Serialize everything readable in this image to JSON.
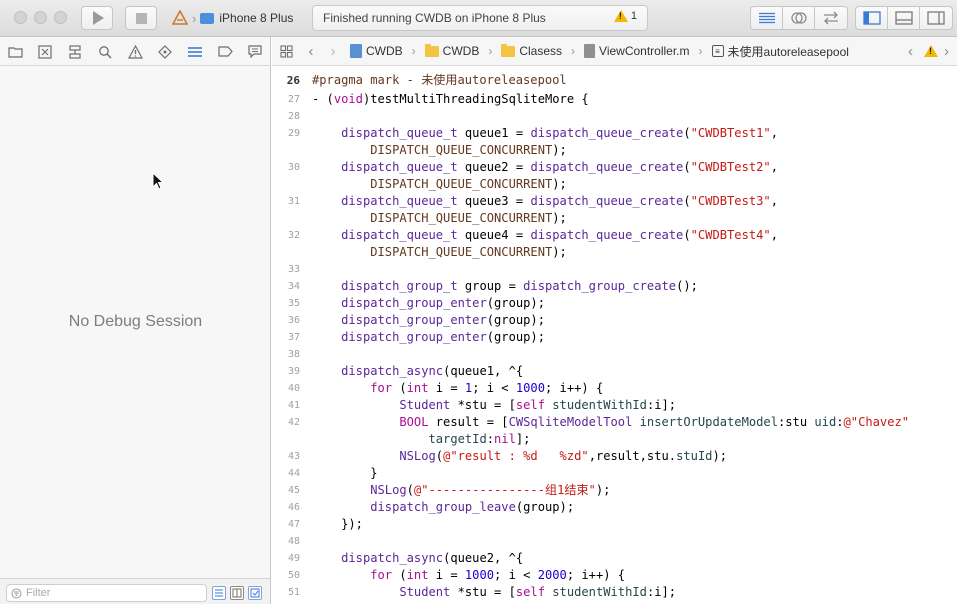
{
  "toolbar": {
    "scheme_device": "iPhone 8 Plus",
    "activity_status": "Finished running CWDB on iPhone 8 Plus",
    "warning_count": "1"
  },
  "left_pane": {
    "empty_message": "No Debug Session",
    "filter_placeholder": "Filter"
  },
  "jump_bar": {
    "crumbs": [
      "CWDB",
      "CWDB",
      "Clasess",
      "ViewController.m",
      "未使用autoreleasepool"
    ]
  },
  "editor": {
    "current_line": 26,
    "lines": [
      {
        "no": "26",
        "text": "#pragma mark - 未使用autoreleasepool"
      },
      {
        "no": "27",
        "text": "- (void)testMultiThreadingSqliteMore {"
      },
      {
        "no": "28",
        "text": ""
      },
      {
        "no": "29",
        "text": "    dispatch_queue_t queue1 = dispatch_queue_create(\"CWDBTest1\","
      },
      {
        "no": "",
        "text": "        DISPATCH_QUEUE_CONCURRENT);"
      },
      {
        "no": "30",
        "text": "    dispatch_queue_t queue2 = dispatch_queue_create(\"CWDBTest2\","
      },
      {
        "no": "",
        "text": "        DISPATCH_QUEUE_CONCURRENT);"
      },
      {
        "no": "31",
        "text": "    dispatch_queue_t queue3 = dispatch_queue_create(\"CWDBTest3\","
      },
      {
        "no": "",
        "text": "        DISPATCH_QUEUE_CONCURRENT);"
      },
      {
        "no": "32",
        "text": "    dispatch_queue_t queue4 = dispatch_queue_create(\"CWDBTest4\","
      },
      {
        "no": "",
        "text": "        DISPATCH_QUEUE_CONCURRENT);"
      },
      {
        "no": "33",
        "text": ""
      },
      {
        "no": "34",
        "text": "    dispatch_group_t group = dispatch_group_create();"
      },
      {
        "no": "35",
        "text": "    dispatch_group_enter(group);"
      },
      {
        "no": "36",
        "text": "    dispatch_group_enter(group);"
      },
      {
        "no": "37",
        "text": "    dispatch_group_enter(group);"
      },
      {
        "no": "38",
        "text": ""
      },
      {
        "no": "39",
        "text": "    dispatch_async(queue1, ^{"
      },
      {
        "no": "40",
        "text": "        for (int i = 1; i < 1000; i++) {"
      },
      {
        "no": "41",
        "text": "            Student *stu = [self studentWithId:i];"
      },
      {
        "no": "42",
        "text": "            BOOL result = [CWSqliteModelTool insertOrUpdateModel:stu uid:@\"Chavez\""
      },
      {
        "no": "",
        "text": "                targetId:nil];"
      },
      {
        "no": "43",
        "text": "            NSLog(@\"result : %d   %zd\",result,stu.stuId);"
      },
      {
        "no": "44",
        "text": "        }"
      },
      {
        "no": "45",
        "text": "        NSLog(@\"----------------组1结束\");"
      },
      {
        "no": "46",
        "text": "        dispatch_group_leave(group);"
      },
      {
        "no": "47",
        "text": "    });"
      },
      {
        "no": "48",
        "text": ""
      },
      {
        "no": "49",
        "text": "    dispatch_async(queue2, ^{"
      },
      {
        "no": "50",
        "text": "        for (int i = 1000; i < 2000; i++) {"
      },
      {
        "no": "51",
        "text": "            Student *stu = [self studentWithId:i];"
      }
    ]
  },
  "icons": {
    "toolbar": [
      "play-icon",
      "stop-icon",
      "app-target-icon",
      "device-icon",
      "warning-icon",
      "editor-standard-icon",
      "editor-assistant-icon",
      "editor-version-icon",
      "navigator-toggle-icon",
      "debug-toggle-icon",
      "utilities-toggle-icon"
    ],
    "navigator": [
      "folder-icon",
      "source-control-icon",
      "symbol-icon",
      "search-icon",
      "issue-icon",
      "test-icon",
      "debug-icon",
      "breakpoint-icon",
      "report-icon"
    ]
  },
  "colors": {
    "keyword": "#aa0d91",
    "string": "#c41a16",
    "number": "#1c00cf",
    "type": "#5c2699",
    "pragma": "#643820",
    "accent": "#4a8fdc",
    "warning": "#f5b800"
  }
}
